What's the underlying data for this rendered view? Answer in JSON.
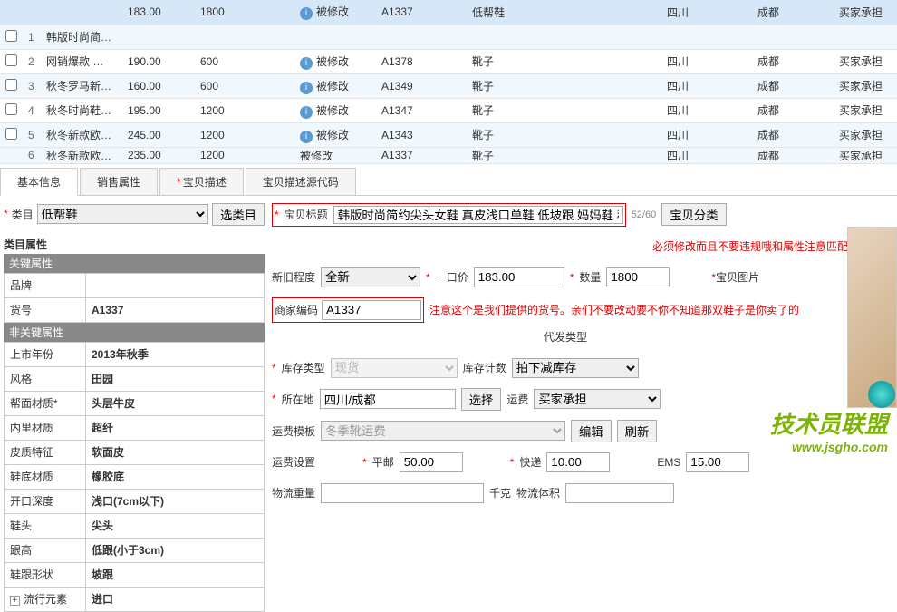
{
  "table": {
    "header": [
      "",
      "",
      "",
      "",
      "",
      "被修改",
      "A1337",
      "低帮鞋",
      "",
      "四川",
      "成都",
      "买家承担"
    ],
    "rows": [
      {
        "idx": "1",
        "name": "韩版时尚简…",
        "price": "183.00",
        "stock": "1800",
        "status": "被修改",
        "code": "A1337",
        "type": "低帮鞋",
        "prov": "四川",
        "city": "成都",
        "ship": "买家承担"
      },
      {
        "idx": "2",
        "name": "网销爆款 …",
        "price": "190.00",
        "stock": "600",
        "status": "被修改",
        "code": "A1378",
        "type": "靴子",
        "prov": "四川",
        "city": "成都",
        "ship": "买家承担"
      },
      {
        "idx": "3",
        "name": "秋冬罗马新…",
        "price": "160.00",
        "stock": "600",
        "status": "被修改",
        "code": "A1349",
        "type": "靴子",
        "prov": "四川",
        "city": "成都",
        "ship": "买家承担"
      },
      {
        "idx": "4",
        "name": "秋冬时尚鞋…",
        "price": "195.00",
        "stock": "1200",
        "status": "被修改",
        "code": "A1347",
        "type": "靴子",
        "prov": "四川",
        "city": "成都",
        "ship": "买家承担"
      },
      {
        "idx": "5",
        "name": "秋冬新款欧…",
        "price": "245.00",
        "stock": "1200",
        "status": "被修改",
        "code": "A1343",
        "type": "靴子",
        "prov": "四川",
        "city": "成都",
        "ship": "买家承担"
      },
      {
        "idx": "6",
        "name": "秋冬新款欧…",
        "price": "235.00",
        "stock": "1200",
        "status": "被修改",
        "code": "A1337",
        "type": "靴子",
        "prov": "四川",
        "city": "成都",
        "ship": "买家承担"
      }
    ]
  },
  "tabs": {
    "basic": "基本信息",
    "sales": "销售属性",
    "desc": "宝贝描述",
    "source": "宝贝描述源代码"
  },
  "category": {
    "label": "类目",
    "value": "低帮鞋",
    "select_btn": "选类目"
  },
  "attr": {
    "header": "类目属性",
    "key_group": "关键属性",
    "nonkey_group": "非关键属性",
    "items": [
      {
        "k": "品牌",
        "v": ""
      },
      {
        "k": "货号",
        "v": "A1337"
      }
    ],
    "nonkey_items": [
      {
        "k": "上市年份",
        "v": "2013年秋季"
      },
      {
        "k": "风格",
        "v": "田园"
      },
      {
        "k": "帮面材质*",
        "v": "头层牛皮"
      },
      {
        "k": "内里材质",
        "v": "超纤"
      },
      {
        "k": "皮质特征",
        "v": "软面皮"
      },
      {
        "k": "鞋底材质",
        "v": "橡胶底"
      },
      {
        "k": "开口深度",
        "v": "浅口(7cm以下)"
      },
      {
        "k": "鞋头",
        "v": "尖头"
      },
      {
        "k": "跟高",
        "v": "低跟(小于3cm)"
      },
      {
        "k": "鞋跟形状",
        "v": "坡跟"
      },
      {
        "k": "流行元素",
        "v": "进口"
      }
    ]
  },
  "form": {
    "title_label": "宝贝标题",
    "title_value": "韩版时尚简约尖头女鞋 真皮浅口单鞋 低坡跟 妈妈鞋 秋鞋",
    "title_count": "52/60",
    "title_note": "必须修改而且不要违规哦和属性注意匹配",
    "cat_btn": "宝贝分类",
    "condition_label": "新旧程度",
    "condition_value": "全新",
    "price_label": "一口价",
    "price_value": "183.00",
    "qty_label": "数量",
    "qty_value": "1800",
    "img_label": "宝贝图片",
    "code_label": "商家编码",
    "code_value": "A1337",
    "code_note": "注意这个是我们提供的货号。亲们不要改动要不你不知道那双鞋子是你卖了的",
    "agent_label": "代发类型",
    "stock_type_label": "库存类型",
    "stock_type_value": "现货",
    "stock_count_label": "库存计数",
    "stock_count_value": "拍下减库存",
    "location_label": "所在地",
    "location_value": "四川/成都",
    "select_btn": "选择",
    "ship_label": "运费",
    "ship_value": "买家承担",
    "ship_tpl_label": "运费模板",
    "ship_tpl_value": "冬季靴运费",
    "edit_btn": "编辑",
    "refresh_btn": "刷新",
    "ship_set_label": "运费设置",
    "surface_label": "平邮",
    "surface_value": "50.00",
    "express_label": "快递",
    "express_value": "10.00",
    "ems_label": "EMS",
    "ems_value": "15.00",
    "weight_label": "物流重量",
    "weight_unit": "千克",
    "volume_label": "物流体积"
  },
  "watermark": {
    "text": "技术员联盟",
    "url": "www.jsgho.com"
  }
}
